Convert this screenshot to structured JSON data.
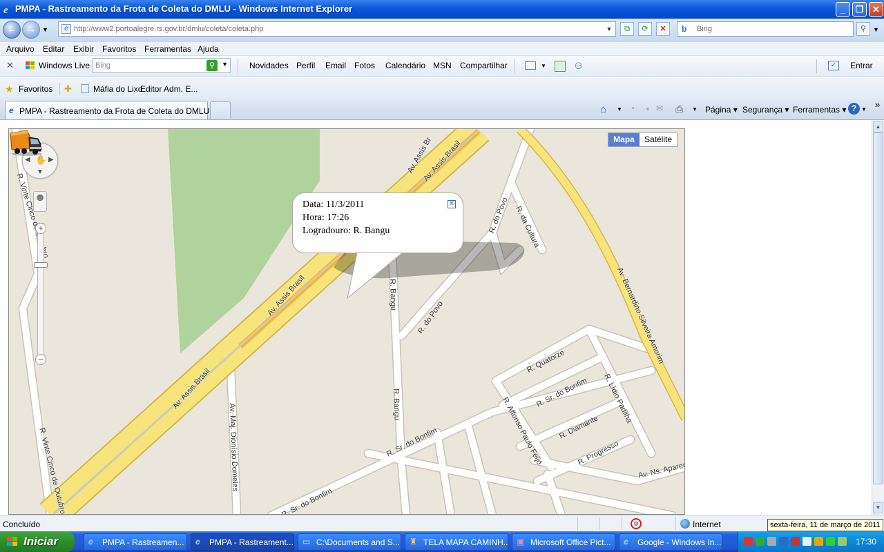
{
  "window": {
    "title": "PMPA - Rastreamento da Frota de Coleta do DMLU - Windows Internet Explorer",
    "min_label": "_",
    "max_label": "❐",
    "close_label": "✕"
  },
  "address": {
    "url": "http://www2.portoalegre.rs.gov.br/dmlu/coleta/coleta.php",
    "search_placeholder": "Bing",
    "search_brand": "b"
  },
  "menu": [
    "Arquivo",
    "Editar",
    "Exibir",
    "Favoritos",
    "Ferramentas",
    "Ajuda"
  ],
  "wltoolbar": {
    "close": "✕",
    "brand": "Windows Live",
    "search_placeholder": "Bing",
    "links": [
      "Novidades",
      "Perfil",
      "Email",
      "Fotos",
      "Calendário",
      "MSN",
      "Compartilhar"
    ],
    "signin": "Entrar"
  },
  "favorites": {
    "label": "Favoritos",
    "links": [
      "Máfia do Lixo",
      "Editor Adm. E..."
    ]
  },
  "tabs": {
    "active": "PMPA - Rastreamento da Frota de Coleta do DMLU"
  },
  "commandbar": {
    "pagina": "Página",
    "seguranca": "Segurança",
    "ferramentas": "Ferramentas",
    "help": "?",
    "more": "»"
  },
  "map": {
    "type_map": "Mapa",
    "type_satellite": "Satélite",
    "zoom_level": 0.24,
    "roads": [
      "Av. Assis Br",
      "Av. Assis Brasil",
      "Av. Assis Brasil",
      "Av. Assis Brasil",
      "R. Vinte Cinco de Outubro",
      "R. Vinte Cinco de Outubro",
      "R. Bangu",
      "R. Bangu",
      "R. do Povo",
      "R. do Povo",
      "R. da Cultura",
      "Av. Bernardino Silveira Amorim",
      "R. Quatorze",
      "R. Sr. do Bonfim",
      "R. Sr. do Bonfim",
      "R. Sr. do Bonfim",
      "R. Lídio Padilha",
      "R. Affonso Paulo Feijó",
      "R. Diamante",
      "R. Progresso",
      "Av. Ns. Apareci",
      "Av. Maj. Dionísio Domeles"
    ],
    "popup": {
      "data": "Data: 11/3/2011",
      "hora": "Hora: 17:26",
      "logradouro": "Logradouro: R. Bangu"
    },
    "colors": {
      "land": "#ebe6dc",
      "park": "#b0d29c",
      "highway": "#f7e47a",
      "highway_center": "#f4b533",
      "street": "#ffffff"
    }
  },
  "status": {
    "text": "Concluído",
    "zone": "Internet",
    "tooltip": "sexta-feira, 11 de março de 2011"
  },
  "taskbar": {
    "start": "Iniciar",
    "items": [
      "PMPA - Rastreamen...",
      "PMPA - Rastreament...",
      "C:\\Documents and S...",
      "TELA MAPA CAMINH...",
      "Microsoft Office Pict...",
      "Google - Windows In..."
    ],
    "clock": "17:30"
  }
}
